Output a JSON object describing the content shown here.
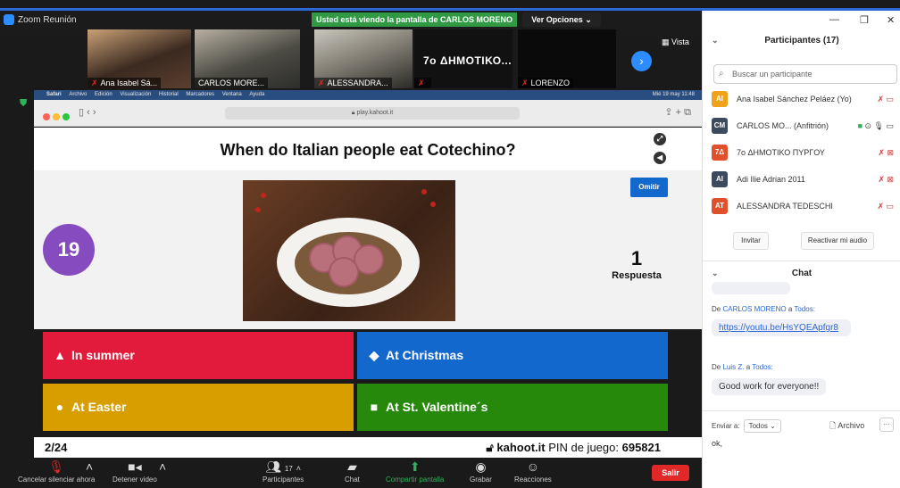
{
  "window": {
    "title": "Zoom Reunión",
    "banner": "Usted está viendo la pantalla de CARLOS MORENO",
    "view_options": "Ver Opciones ⌄",
    "view_label": "Vista"
  },
  "tiles": [
    {
      "name": "Ana Isabel Sá..."
    },
    {
      "name": "CARLOS MORE..."
    },
    {
      "name": "ALESSANDRA..."
    },
    {
      "name": "",
      "big": "7o ΔΗΜΟΤΙΚΟ..."
    },
    {
      "name": "LORENZO"
    }
  ],
  "mac_menu": [
    "Safari",
    "Archivo",
    "Edición",
    "Visualización",
    "Historial",
    "Marcadores",
    "Ventana",
    "Ayuda"
  ],
  "mac_clock": "Mié 19 may 11:48",
  "browser": {
    "url": "play.kahoot.it"
  },
  "kahoot": {
    "question": "When do Italian people eat Cotechino?",
    "timer": "19",
    "skip": "Omitir",
    "answers_count": "1",
    "answers_label": "Respuesta",
    "answers": [
      {
        "shape": "▲",
        "text": "In summer",
        "color": "#e21b3c"
      },
      {
        "shape": "◆",
        "text": "At Christmas",
        "color": "#1368ce"
      },
      {
        "shape": "●",
        "text": "At Easter",
        "color": "#d89e00"
      },
      {
        "shape": "■",
        "text": "At St. Valentine´s",
        "color": "#26890c"
      }
    ],
    "progress": "2/24",
    "site": "kahoot.it",
    "pin_label": "PIN de juego:",
    "pin": "695821"
  },
  "toolbar": {
    "unmute": "Cancelar silenciar ahora",
    "video": "Detener video",
    "participants": "Participantes",
    "participants_count": "17",
    "chat": "Chat",
    "share": "Compartir pantalla",
    "record": "Grabar",
    "reactions": "Reacciones",
    "leave": "Salir"
  },
  "sidebar": {
    "participants_title": "Participantes (17)",
    "search_placeholder": "Buscar un participante",
    "participants": [
      {
        "initials": "AI",
        "name": "Ana Isabel Sánchez Peláez (Yo)",
        "color": "#f0a21a"
      },
      {
        "initials": "CM",
        "name": "CARLOS MO... (Anfitrión)",
        "color": "#3b4a5c"
      },
      {
        "initials": "7Δ",
        "name": "7o ΔΗΜΟΤΙΚΟ ΠΥΡΓΟΥ",
        "color": "#e0502b"
      },
      {
        "initials": "AI",
        "name": "Adi Ilie Adrian 2011",
        "color": "#3b4a5c"
      },
      {
        "initials": "AT",
        "name": "ALESSANDRA TEDESCHI",
        "color": "#e0502b"
      }
    ],
    "invite": "Invitar",
    "reactivate": "Reactivar mi audio",
    "chat_title": "Chat",
    "messages": [
      {
        "from": "CARLOS MORENO",
        "sep": "a",
        "to": "Todos:",
        "text": "https://youtu.be/HsYQEApfgr8",
        "link": true
      },
      {
        "from": "Luis Z.",
        "sep": "a",
        "to": "Todos:",
        "text": "Good work for everyone!!",
        "link": false
      }
    ],
    "from_prefix": "De",
    "send_to_label": "Enviar a:",
    "send_to_value": "Todos ⌄",
    "file_label": "Archivo",
    "compose_text": "ok,"
  }
}
